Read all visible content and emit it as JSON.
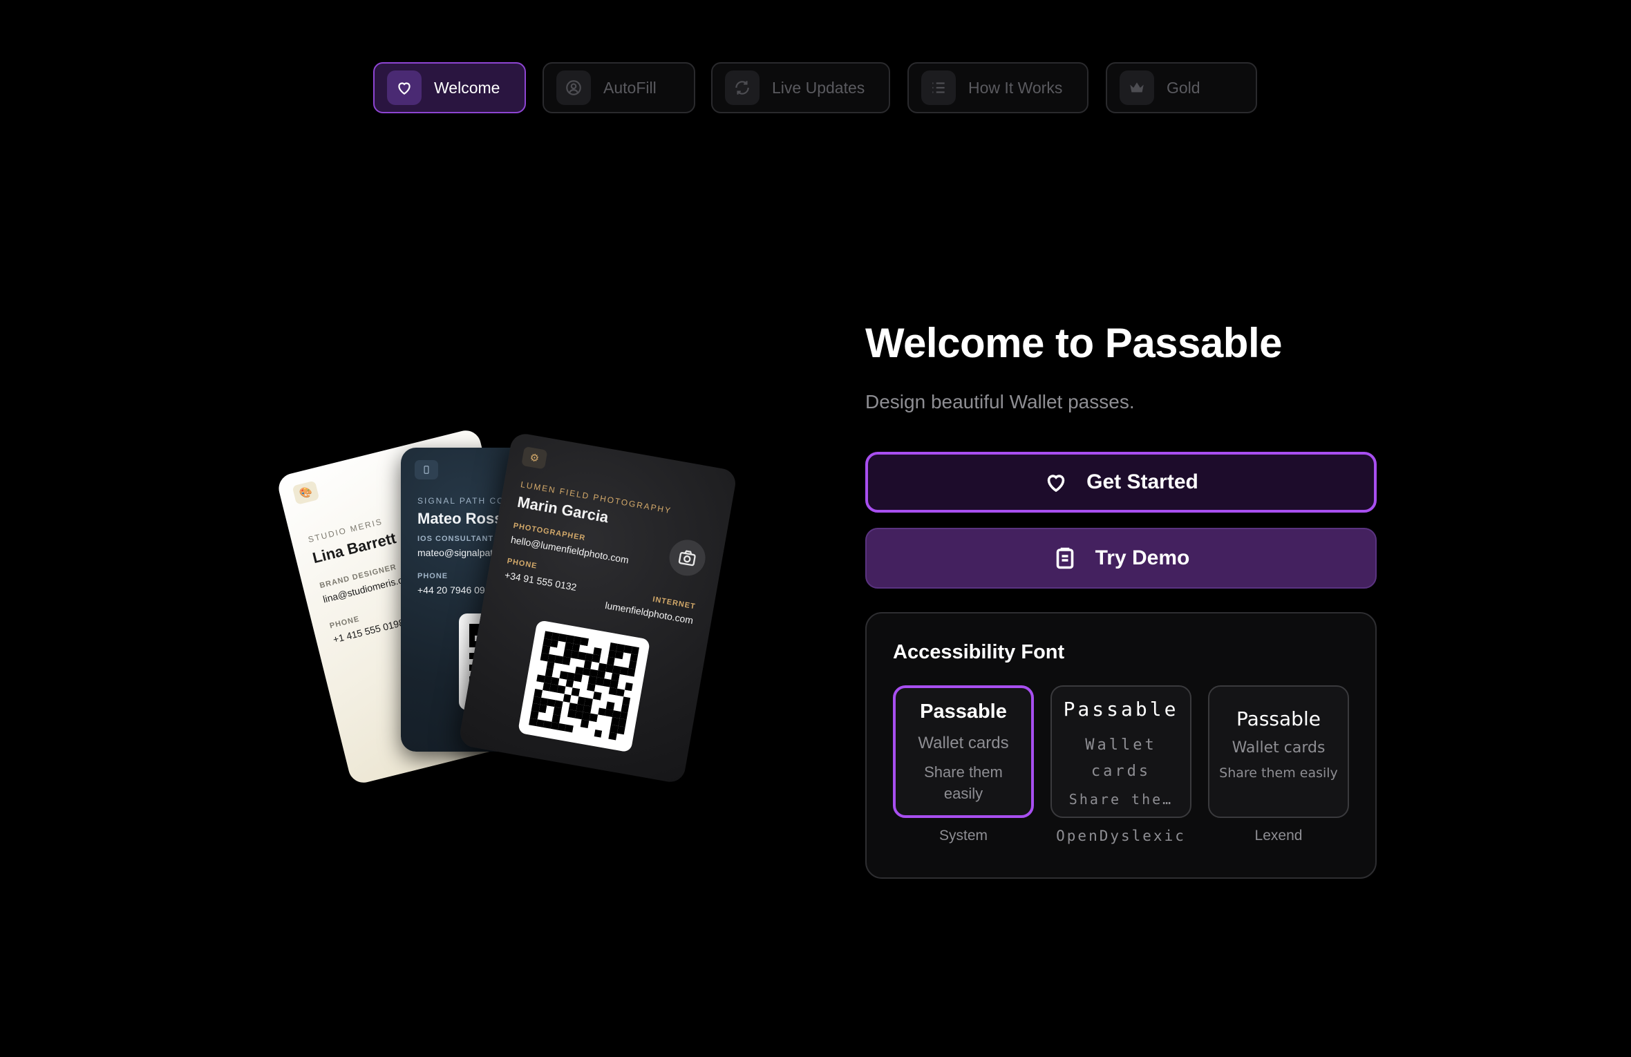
{
  "tabs": [
    {
      "label": "Welcome",
      "icon": "heart-icon",
      "active": true
    },
    {
      "label": "AutoFill",
      "icon": "person-circle-icon",
      "active": false
    },
    {
      "label": "Live Updates",
      "icon": "refresh-icon",
      "active": false
    },
    {
      "label": "How It Works",
      "icon": "list-icon",
      "active": false
    },
    {
      "label": "Gold",
      "icon": "crown-icon",
      "active": false
    }
  ],
  "cards": {
    "white": {
      "org": "STUDIO MERIS",
      "name": "Lina Barrett",
      "role_label": "BRAND DESIGNER",
      "email": "lina@studiomeris.co",
      "phone_label": "PHONE",
      "phone": "+1 415 555 0198"
    },
    "navy": {
      "org": "SIGNAL PATH CONS",
      "name": "Mateo Rossi",
      "role_label": "IOS CONSULTANT",
      "email": "mateo@signalpath",
      "phone_label": "PHONE",
      "phone": "+44 20 7946 09"
    },
    "dark": {
      "org": "LUMEN FIELD PHOTOGRAPHY",
      "name": "Marin Garcia",
      "role_label": "PHOTOGRAPHER",
      "email": "hello@lumenfieldphoto.com",
      "phone_label": "PHONE",
      "phone": "+34 91 555 0132",
      "web_label": "INTERNET",
      "web": "lumenfieldphoto.com"
    }
  },
  "welcome": {
    "title": "Welcome to Passable",
    "subtitle": "Design beautiful Wallet passes."
  },
  "buttons": {
    "get_started": "Get Started",
    "try_demo": "Try Demo"
  },
  "font_panel": {
    "title": "Accessibility Font",
    "options": [
      {
        "title": "Passable",
        "line1": "Wallet cards",
        "line2": "Share them easily",
        "caption": "System",
        "selected": true
      },
      {
        "title": "Passable",
        "line1": "Wallet cards",
        "line2": "Share the…",
        "caption": "OpenDyslexic",
        "selected": false
      },
      {
        "title": "Passable",
        "line1": "Wallet cards",
        "line2": "Share them easily",
        "caption": "Lexend",
        "selected": false
      }
    ]
  },
  "colors": {
    "accent": "#a84ff0",
    "button_primary_bg": "#1d0c2b",
    "button_secondary_bg": "#44215f",
    "background": "#000000"
  }
}
